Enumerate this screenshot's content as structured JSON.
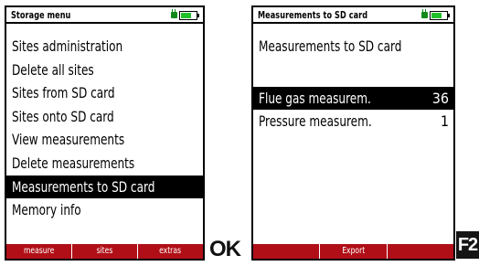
{
  "left_screen": {
    "title": "Storage menu",
    "battery_level": 0.7,
    "battery_color": "#22c12a",
    "plug_color": "#118a1a",
    "items": [
      {
        "label": "Sites administration",
        "selected": false
      },
      {
        "label": "Delete all sites",
        "selected": false
      },
      {
        "label": "Sites from SD card",
        "selected": false
      },
      {
        "label": "Sites onto SD card",
        "selected": false
      },
      {
        "label": "View measurements",
        "selected": false
      },
      {
        "label": "Delete measurements",
        "selected": false
      },
      {
        "label": "Measurements to SD card",
        "selected": true
      },
      {
        "label": "Memory info",
        "selected": false
      }
    ],
    "softkeys": [
      "measure",
      "sites",
      "extras"
    ],
    "softkey_color": "#b00f17"
  },
  "right_screen": {
    "title": "Measurements to SD card",
    "heading": "Measurements to SD card",
    "rows": [
      {
        "label": "Flue gas measurem.",
        "count": "36",
        "selected": true
      },
      {
        "label": "Pressure measurem.",
        "count": "1",
        "selected": false
      }
    ],
    "softkeys": [
      "",
      "Export",
      ""
    ]
  },
  "keys": {
    "ok": "OK",
    "f2": "F2"
  }
}
